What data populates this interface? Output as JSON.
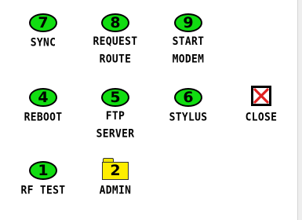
{
  "buttons": {
    "sync": {
      "key": "7",
      "label": "SYNC"
    },
    "request_route": {
      "key": "8",
      "label_line1": "REQUEST",
      "label_line2": "ROUTE"
    },
    "start_modem": {
      "key": "9",
      "label_line1": "START",
      "label_line2": "MODEM"
    },
    "reboot": {
      "key": "4",
      "label": "REBOOT"
    },
    "ftp_server": {
      "key": "5",
      "label_line1": "FTP",
      "label_line2": "SERVER"
    },
    "stylus": {
      "key": "6",
      "label": "STYLUS"
    },
    "close": {
      "icon": "close-x-icon",
      "label": "CLOSE"
    },
    "rf_test": {
      "key": "1",
      "label": "RF TEST"
    },
    "admin": {
      "icon": "folder-icon",
      "key": "2",
      "label": "ADMIN"
    }
  },
  "colors": {
    "key_fill": "#11dd11",
    "key_border": "#000000",
    "folder_fill": "#ffee00",
    "close_x": "#e02020",
    "background": "#ffffff"
  }
}
